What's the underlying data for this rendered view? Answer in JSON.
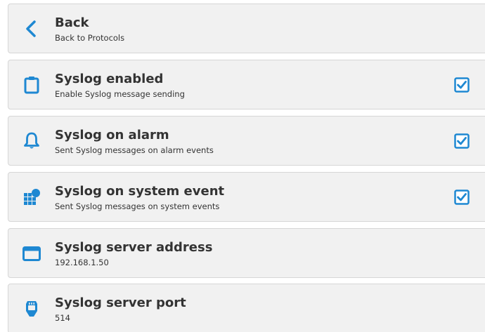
{
  "accent_color": "#1e88d2",
  "rows": [
    {
      "title": "Back",
      "subtitle": "Back to Protocols",
      "icon": "chevron-left-icon"
    },
    {
      "title": "Syslog enabled",
      "subtitle": "Enable Syslog message sending",
      "icon": "clipboard-icon",
      "checked": true
    },
    {
      "title": "Syslog on alarm",
      "subtitle": "Sent Syslog messages on alarm events",
      "icon": "bell-icon",
      "checked": true
    },
    {
      "title": "Syslog on system event",
      "subtitle": "Sent Syslog messages on system events",
      "icon": "grid-event-icon",
      "checked": true
    },
    {
      "title": "Syslog server address",
      "subtitle": "192.168.1.50",
      "icon": "window-icon"
    },
    {
      "title": "Syslog server port",
      "subtitle": "514",
      "icon": "ethernet-port-icon"
    }
  ]
}
